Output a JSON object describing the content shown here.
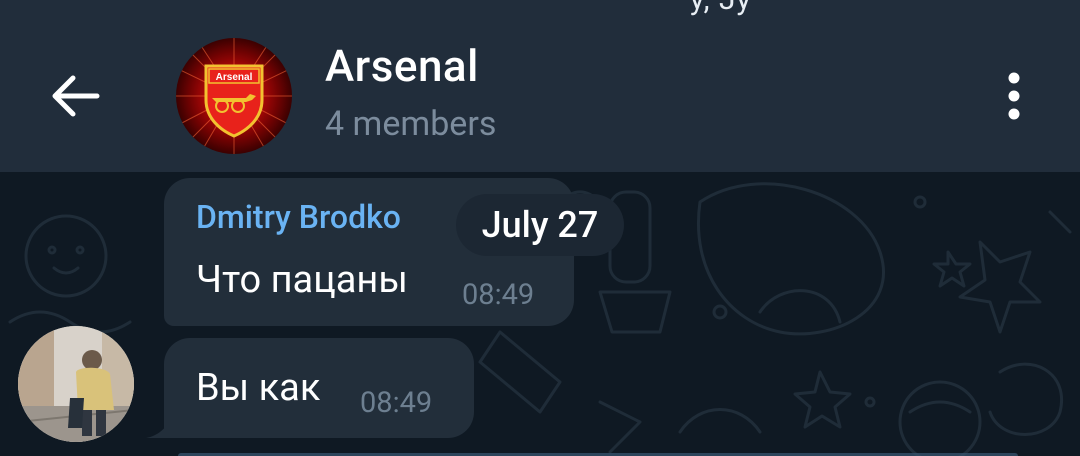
{
  "status_bar": {
    "partial_text": "y, Jy"
  },
  "header": {
    "back_icon": "arrow-left-icon",
    "group_name": "Arsenal",
    "members": "4 members",
    "avatar_crest_text": "Arsenal",
    "menu_icon": "more-vertical-icon"
  },
  "chat": {
    "date_label": "July 27",
    "messages": [
      {
        "sender": "Dmitry Brodko",
        "text": "Что пацаны",
        "time": "08:49"
      },
      {
        "sender": "",
        "text": "Вы как",
        "time": "08:49"
      }
    ]
  },
  "colors": {
    "header_bg": "#212d3b",
    "chat_bg": "#0f1923",
    "bubble_bg": "#222e3a",
    "sender_color": "#6ab3f3",
    "time_color": "#6d7f90",
    "members_color": "#7c8c9d"
  }
}
